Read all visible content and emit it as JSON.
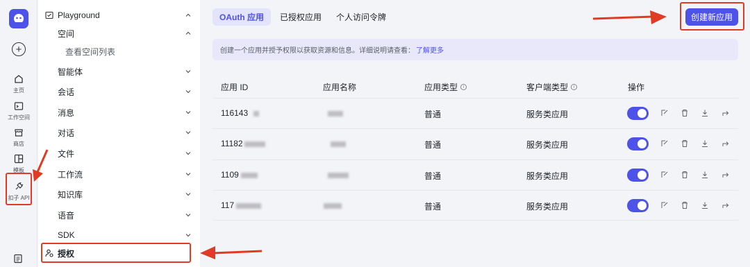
{
  "rail": {
    "items": [
      {
        "label": "主页",
        "icon": "home-icon"
      },
      {
        "label": "工作空间",
        "icon": "terminal-icon"
      },
      {
        "label": "商店",
        "icon": "store-icon"
      },
      {
        "label": "模板",
        "icon": "template-icon"
      },
      {
        "label": "扣子 API",
        "icon": "api-plug-icon"
      }
    ]
  },
  "sidebar": {
    "playground": "Playground",
    "items": [
      {
        "label": "空间"
      },
      {
        "label": "查看空间列表"
      },
      {
        "label": "智能体"
      },
      {
        "label": "会话"
      },
      {
        "label": "消息"
      },
      {
        "label": "对话"
      },
      {
        "label": "文件"
      },
      {
        "label": "工作流"
      },
      {
        "label": "知识库"
      },
      {
        "label": "语音"
      },
      {
        "label": "SDK"
      }
    ],
    "active": "授权"
  },
  "tabs": [
    {
      "label": "OAuth 应用",
      "active": true
    },
    {
      "label": "已授权应用",
      "active": false
    },
    {
      "label": "个人访问令牌",
      "active": false
    }
  ],
  "create_button": "创建新应用",
  "banner": {
    "text": "创建一个应用并授予权限以获取资源和信息。详细说明请查看：",
    "link": "了解更多"
  },
  "table": {
    "headers": [
      "应用 ID",
      "应用名称",
      "应用类型",
      "客户端类型",
      "操作"
    ],
    "rows": [
      {
        "id": "116143",
        "type": "普通",
        "client": "服务类应用",
        "enabled": true
      },
      {
        "id": "11182",
        "type": "普通",
        "client": "服务类应用",
        "enabled": true
      },
      {
        "id": "1109",
        "type": "普通",
        "client": "服务类应用",
        "enabled": true
      },
      {
        "id": "117",
        "type": "普通",
        "client": "服务类应用",
        "enabled": true
      }
    ],
    "actions": [
      "edit-icon",
      "delete-icon",
      "download-icon",
      "share-icon"
    ]
  },
  "colors": {
    "accent": "#4d53e8",
    "annotation": "#e03b24"
  }
}
